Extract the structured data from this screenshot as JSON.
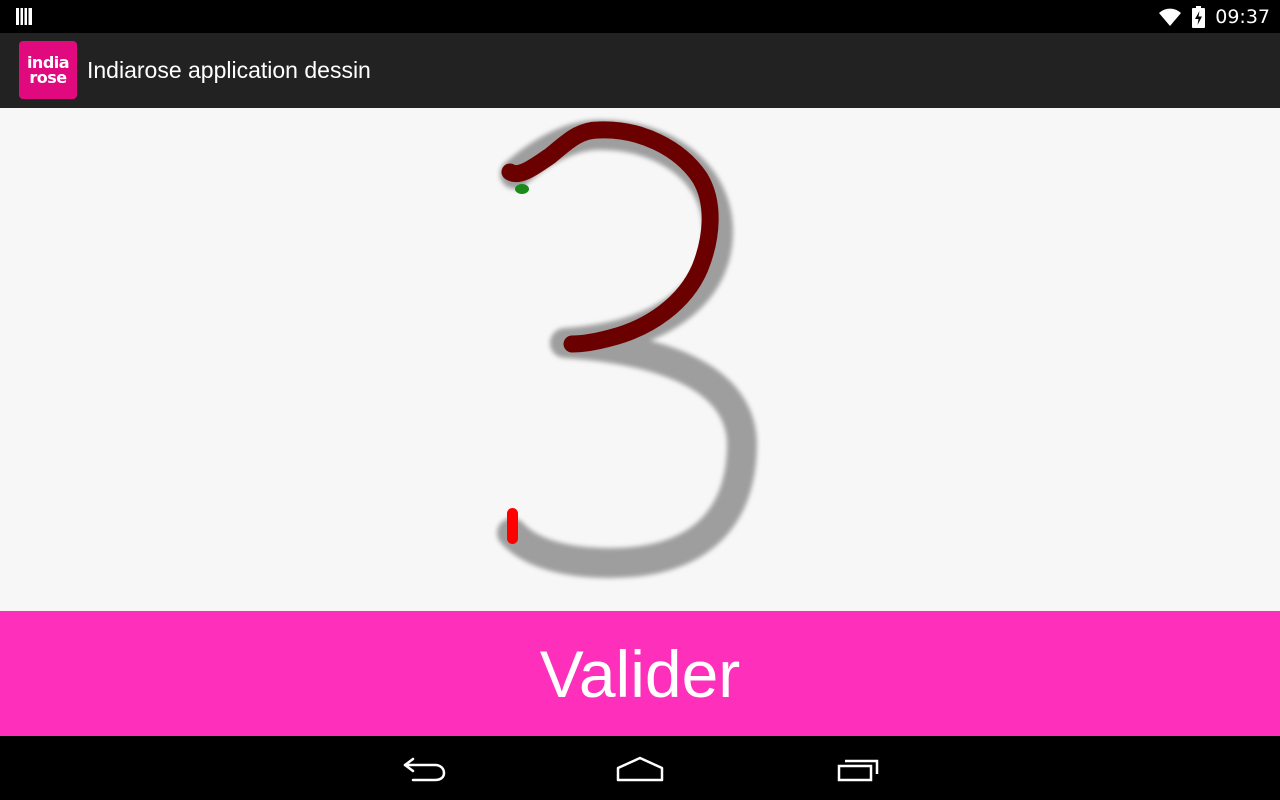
{
  "status_bar": {
    "time": "09:37",
    "icons": [
      "notification-icon",
      "wifi-icon",
      "battery-charging-icon"
    ]
  },
  "action_bar": {
    "app_icon_line1": "india",
    "app_icon_line2": "rose",
    "title": "Indiarose application dessin"
  },
  "canvas": {
    "digit": "3",
    "guide_color": "#9a9a9a",
    "stroke_color": "#6b0000",
    "start_marker_color": "#1a8a1a",
    "end_marker_color": "#ff0000"
  },
  "validate": {
    "label": "Valider",
    "color": "#fd2fbb"
  },
  "nav_bar": {
    "icons": [
      "back-icon",
      "home-icon",
      "recent-apps-icon"
    ]
  }
}
